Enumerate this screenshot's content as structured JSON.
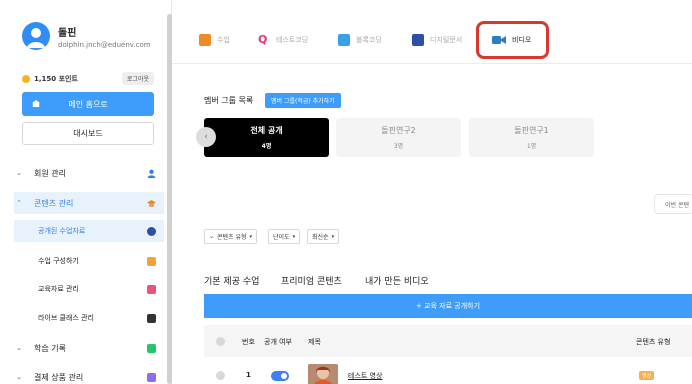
{
  "user": {
    "name": "돌핀",
    "email": "dolphin.jnch@eduenv.com",
    "points": "1,150 포인트",
    "logout_label": "로그아웃"
  },
  "sidebar": {
    "home_label": "메인 홈으로",
    "dashboard_label": "대시보드",
    "items": [
      {
        "label": "회원 관리",
        "icon": "user-icon",
        "color": "#2f80ed"
      },
      {
        "label": "콘텐츠 관리",
        "icon": "graduation-cap-icon",
        "color": "#f08a24"
      },
      {
        "label": "학습 기록",
        "icon": "document-icon",
        "color": "#27c46b"
      },
      {
        "label": "결제 상품 관리",
        "icon": "shop-icon",
        "color": "#8e6cf0"
      }
    ],
    "sub_items": [
      {
        "label": "공개된 수업자료",
        "icon": "lesson-icon",
        "color": "#2d4fa8"
      },
      {
        "label": "수업 구성하기",
        "icon": "compose-icon",
        "color": "#f5a23a"
      },
      {
        "label": "교육자료 관리",
        "icon": "material-icon",
        "color": "#e8557a"
      },
      {
        "label": "라이브 클래스 관리",
        "icon": "live-class-icon",
        "color": "#333333"
      }
    ]
  },
  "tabs": [
    {
      "label": "수업",
      "icon": "book-icon",
      "color": "#f08a24"
    },
    {
      "label": "테스트코딩",
      "icon": "q-icon",
      "color": "#f0306a"
    },
    {
      "label": "블록코딩",
      "icon": "block-icon",
      "color": "#3aa0e8"
    },
    {
      "label": "디지털문서",
      "icon": "document-icon",
      "color": "#2d4fa8"
    },
    {
      "label": "비디오",
      "icon": "video-camera-icon",
      "color": "#2f7fbf"
    }
  ],
  "groups": {
    "title": "멤버 그룹 목록",
    "add_label": "멤버 그룹(학급) 추가하기",
    "cards": [
      {
        "name": "전체 공개",
        "count": "4명"
      },
      {
        "name": "돌핀연구2",
        "count": "3명"
      },
      {
        "name": "돌핀연구1",
        "count": "1명"
      }
    ]
  },
  "right_chip_label": "이번 콘텐",
  "filters": [
    "콘텐츠 유형",
    "난이도",
    "최신순"
  ],
  "content_tabs": [
    "기본 제공 수업",
    "프리미엄 콘텐츠",
    "내가 만든 비디오"
  ],
  "share_button_label": "+ 교육 자료 공개하기",
  "table": {
    "columns": [
      "번호",
      "공개 여부",
      "제목",
      "콘텐츠 유형"
    ],
    "rows": [
      {
        "number": "1",
        "title": "테스트 영상",
        "type": "영상"
      }
    ]
  }
}
